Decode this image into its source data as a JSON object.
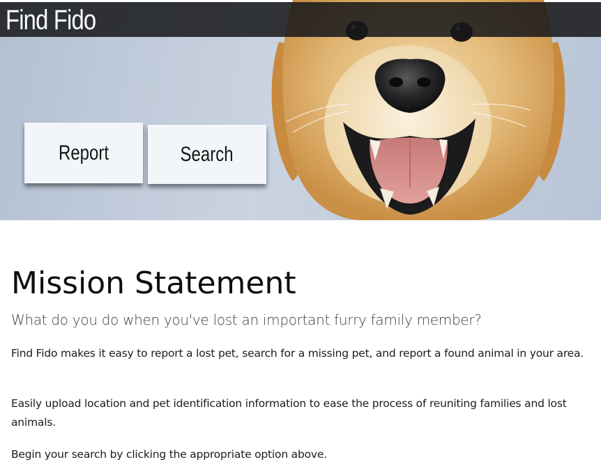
{
  "header": {
    "site_title": "Find Fido"
  },
  "hero": {
    "image": "golden-retriever-photo",
    "buttons": [
      {
        "label": "Report"
      },
      {
        "label": "Search"
      }
    ]
  },
  "main": {
    "heading": "Mission Statement",
    "subheading": "What do you do when you've lost an important furry family member?",
    "paragraphs": [
      "Find Fido makes it easy to report a lost pet, search for a missing pet, and report a found animal in your area.",
      "Easily upload location and pet identification information to ease the process of reuniting families and lost animals.",
      "Begin your search by clicking the appropriate option above."
    ]
  }
}
